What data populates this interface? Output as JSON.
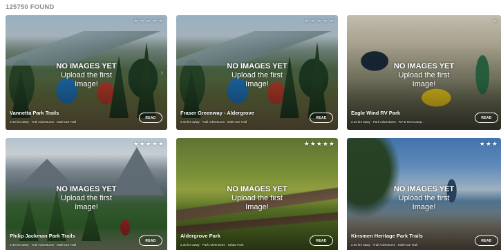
{
  "results": {
    "count_label": "125750 FOUND"
  },
  "placeholder": {
    "line1": "NO IMAGES YET",
    "line2": "Upload the first",
    "line3": "Image!"
  },
  "cards": [
    {
      "title": "Vannetta Park Trails",
      "meta": "2.00 km away · Trail Adventures · Multi-use Trail",
      "stars": "★★★★★",
      "read_label": "READ"
    },
    {
      "title": "Fraser Greenway - Aldergrove",
      "meta": "2.10 km away · Trail Adventures · Multi-use Trail",
      "stars": "★★★★★",
      "read_label": "READ"
    },
    {
      "title": "Eagle Wind RV Park",
      "meta": "2.10 km away · Park Adventures · RV & Tent Camp...",
      "stars": "★",
      "read_label": "READ"
    },
    {
      "title": "Philip Jackman Park Trails",
      "meta": "2.30 km away · Trail Adventures · Multi-use Trail",
      "stars": "★★★★★",
      "read_label": "READ"
    },
    {
      "title": "Aldergrove Park",
      "meta": "2.30 km away · Park Adventures · Urban Park",
      "stars": "★★★★★",
      "read_label": "READ"
    },
    {
      "title": "Kinsmen Heritage Park Trails",
      "meta": "2.40 km away · Trail Adventures · Multi-use Trail",
      "stars": "★★★",
      "read_label": "READ"
    }
  ],
  "icons": {
    "star": "star-icon",
    "arrow": "chevron-right-icon"
  }
}
